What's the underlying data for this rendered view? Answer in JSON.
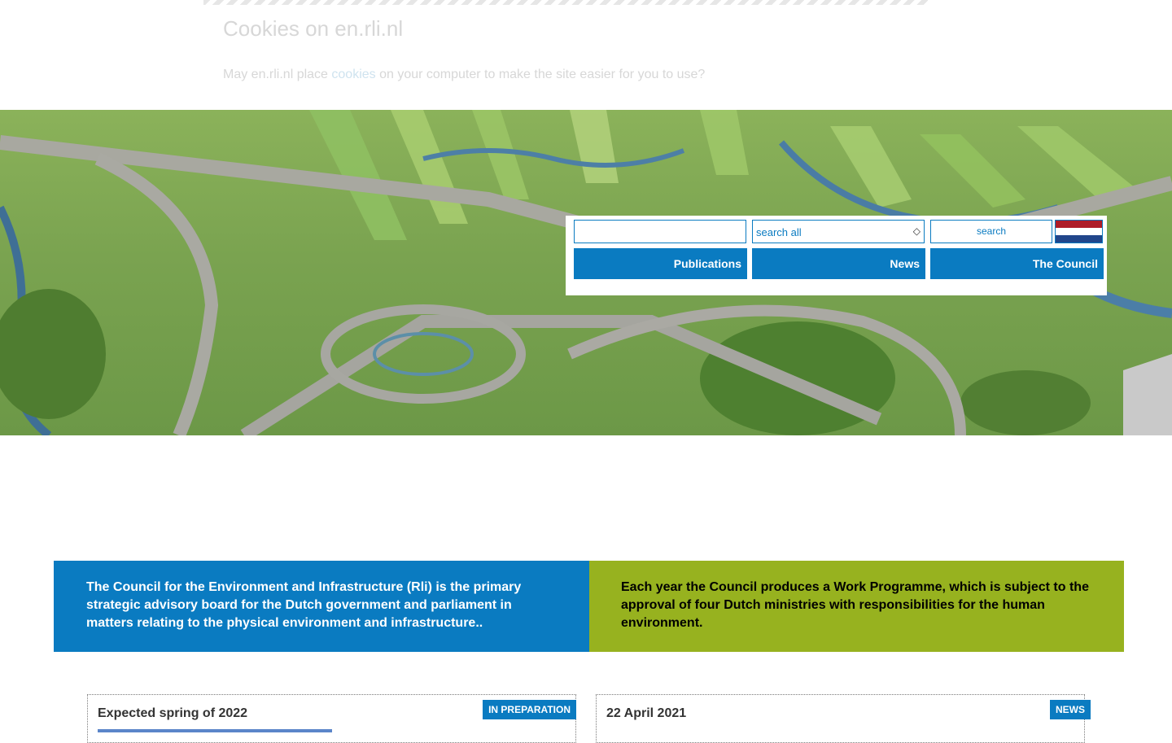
{
  "cookie": {
    "title": "Cookies on en.rli.nl",
    "text_before": "May en.rli.nl place ",
    "link": "cookies",
    "text_after": " on your computer to make the site easier for you to use?"
  },
  "header": {
    "search_placeholder": "",
    "select_value": "search all",
    "search_button": "search",
    "nav": [
      "Publications",
      "News",
      "The Council"
    ],
    "flag_colors": [
      "#ae1c28",
      "#ffffff",
      "#21468b"
    ]
  },
  "info": {
    "left": "The Council for the Environment and Infrastructure (Rli) is the primary strategic advisory board for the Dutch government and parliament in matters relating to the physical environment and infrastructure..",
    "right": "Each year the Council produces a Work Programme, which is subject to the approval of four Dutch ministries with responsibilities for the human environment."
  },
  "cards": [
    {
      "date": "Expected spring of 2022",
      "badge": "IN PREPARATION"
    },
    {
      "date": "22 April 2021",
      "badge": "NEWS"
    }
  ],
  "colors": {
    "accent": "#0a7bc1",
    "green": "#97b21f"
  }
}
